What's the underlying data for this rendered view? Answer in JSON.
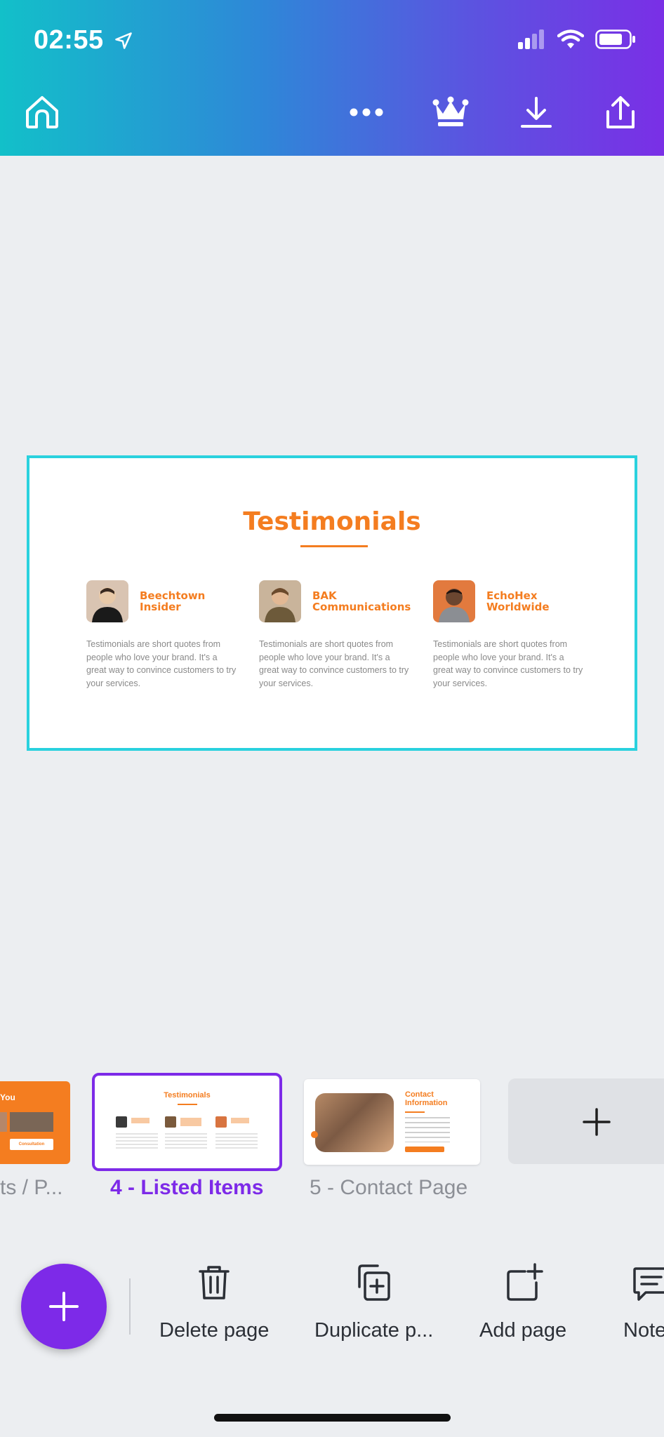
{
  "status_bar": {
    "time": "02:55"
  },
  "toolbar": {
    "home_icon": "home-icon",
    "more_icon": "more-icon",
    "crown_icon": "crown-icon",
    "download_icon": "download-icon",
    "share_icon": "share-icon"
  },
  "slide": {
    "title": "Testimonials",
    "cards": [
      {
        "name": "Beechtown Insider",
        "text": "Testimonials are short quotes from people who love your brand. It's a great way to convince customers to try your services."
      },
      {
        "name": "BAK Communications",
        "text": "Testimonials are short quotes from people who love your brand. It's a great way to convince customers to try your services."
      },
      {
        "name": "EchoHex Worldwide",
        "text": "Testimonials are short quotes from people who love your brand. It's a great way to convince customers to try your services."
      }
    ],
    "accent": "#f47d20",
    "border": "#2ad1de"
  },
  "pages": [
    {
      "label": "ts / P...",
      "thumb_text": "You",
      "thumb_button": "Consultation"
    },
    {
      "label": "4 - Listed Items",
      "thumb_text": "Testimonials",
      "selected": true
    },
    {
      "label": "5 - Contact Page",
      "thumb_text": "Contact Information"
    }
  ],
  "actions": {
    "delete": "Delete page",
    "duplicate": "Duplicate p...",
    "add": "Add page",
    "notes": "Note"
  },
  "colors": {
    "brand": "#7d2ae8",
    "selected_label": "#7d2ae8",
    "muted_label": "#8c8f96"
  }
}
